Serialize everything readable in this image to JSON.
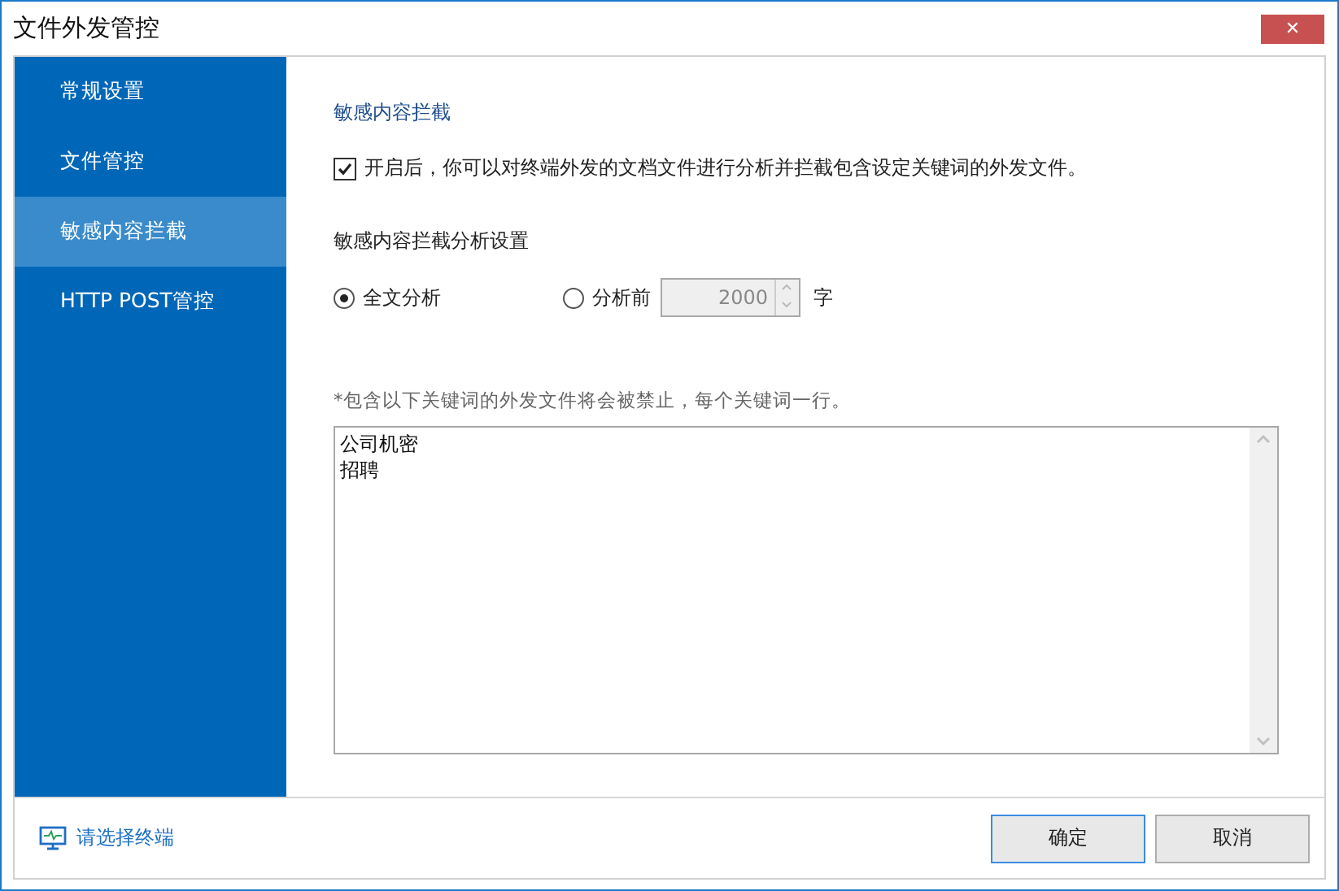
{
  "window": {
    "title": "文件外发管控",
    "close": "✕"
  },
  "sidebar": {
    "items": [
      {
        "label": "常规设置",
        "selected": false
      },
      {
        "label": "文件管控",
        "selected": false
      },
      {
        "label": "敏感内容拦截",
        "selected": true
      },
      {
        "label": "HTTP POST管控",
        "selected": false
      }
    ]
  },
  "section_title": "敏感内容拦截",
  "enable": {
    "label": "开启后，你可以对终端外发的文档文件进行分析并拦截包含设定关键词的外发文件。",
    "checked": true
  },
  "analysis": {
    "title": "敏感内容拦截分析设置",
    "options": [
      {
        "label": "全文分析",
        "selected": true
      },
      {
        "label": "分析前",
        "selected": false
      }
    ],
    "count": {
      "value": "2000",
      "disabled": true
    },
    "unit": "字"
  },
  "keywords": {
    "hint": "*包含以下关键词的外发文件将会被禁止，每个关键词一行。",
    "lines": [
      "公司机密",
      "招聘"
    ]
  },
  "footer": {
    "terminal_link": "请选择终端",
    "buttons": [
      {
        "label": "确定",
        "kind": "primary"
      },
      {
        "label": "取消",
        "kind": "normal"
      }
    ]
  }
}
